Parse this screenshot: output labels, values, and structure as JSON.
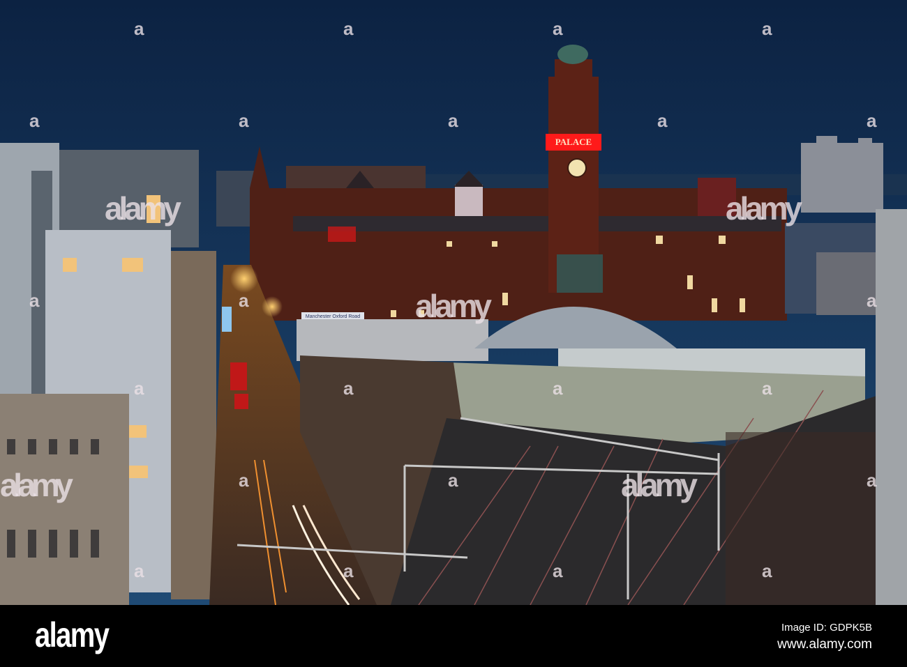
{
  "photo": {
    "description_labels": {
      "tower_sign": "PALACE",
      "station_sign": "Manchester Oxford Road"
    },
    "colors": {
      "sky_top": "#0e2444",
      "sky_bottom": "#1e4670",
      "brick": "#5a2418",
      "neon": "#ff2020",
      "street_light": "#f3a13a"
    }
  },
  "watermark": {
    "letter": "a",
    "word": "alamy"
  },
  "footer": {
    "brand": "alamy",
    "image_id": "Image ID: GDPK5B",
    "website": "www.alamy.com"
  }
}
